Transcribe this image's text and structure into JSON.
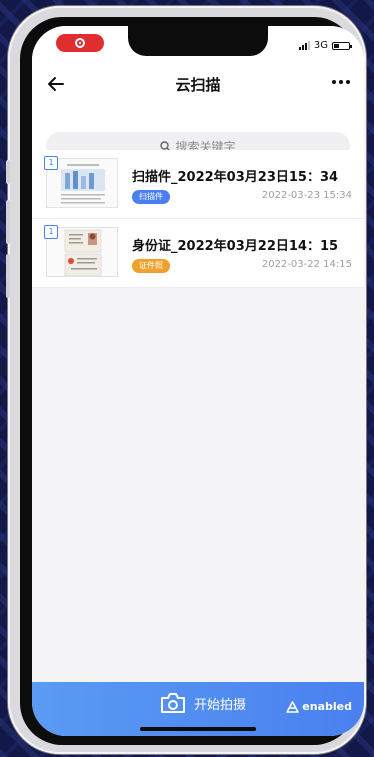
{
  "header": {
    "title": "云扫描"
  },
  "status": {
    "network": "3G"
  },
  "search": {
    "placeholder": "搜索关键字"
  },
  "files": [
    {
      "pages": "1",
      "name": "扫描件_2022年03月23日15：34",
      "tag": "扫描件",
      "tag_color": "#4a7ff0",
      "date": "2022-03-23 15:34"
    },
    {
      "pages": "1",
      "name": "身份证_2022年03月22日14：15",
      "tag": "证件照",
      "tag_color": "#f0a12c",
      "date": "2022-03-22 14:15"
    }
  ],
  "bottom": {
    "scan_label": "开始拍摄",
    "brand": "enabled"
  },
  "icons": [
    "record-icon",
    "back-arrow-icon",
    "more-icon",
    "search-icon",
    "camera-icon",
    "brand-logo-icon"
  ]
}
